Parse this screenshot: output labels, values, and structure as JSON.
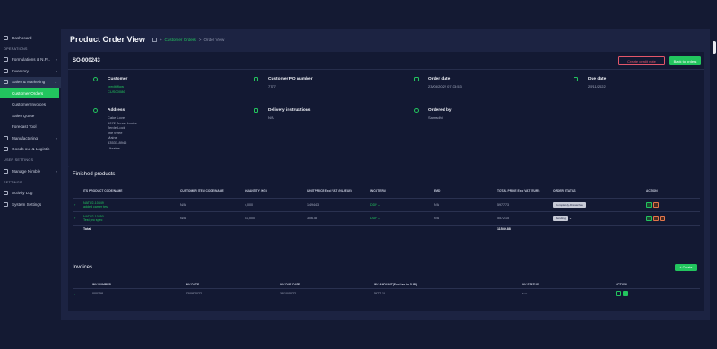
{
  "sidebar": {
    "items": [
      {
        "label": "Dashboard",
        "icon": "dashboard-icon"
      },
      {
        "section": "OPERATIONS"
      },
      {
        "label": "Formulations & N.P...",
        "icon": "flask-icon",
        "chev": "›"
      },
      {
        "label": "Inventory",
        "icon": "box-icon",
        "chev": "›"
      },
      {
        "label": "Sales & Marketing",
        "icon": "dollar-icon",
        "chev": "⌄",
        "open": true
      },
      {
        "label": "Customer Orders",
        "sub": true,
        "active": true
      },
      {
        "label": "Customer Invoices",
        "sub": true
      },
      {
        "label": "Sales Quote",
        "sub": true
      },
      {
        "label": "Forecast Tool",
        "sub": true
      },
      {
        "label": "Manufacturing",
        "icon": "factory-icon",
        "chev": "›"
      },
      {
        "label": "Goods out & Logistic",
        "icon": "truck-icon"
      },
      {
        "section": "USER SETTINGS"
      },
      {
        "label": "Manage Nimble",
        "icon": "settings-icon",
        "chev": "›"
      },
      {
        "section": "SETTINGS"
      },
      {
        "label": "Activity Log",
        "icon": "log-icon"
      },
      {
        "label": "System Settings",
        "icon": "gear-icon"
      }
    ]
  },
  "header": {
    "title": "Product Order View",
    "crumb_link": "Customer Orders",
    "crumb_sep": ">",
    "crumb_current": "Order View"
  },
  "order": {
    "number": "SO-000243",
    "create_credit_note": "Create credit note",
    "back_to_orders": "Back to orders",
    "customer_label": "Customer",
    "customer_name": "credit flow",
    "customer_code": "CUS00086",
    "po_label": "Customer PO number",
    "po_value": "7777",
    "order_date_label": "Order date",
    "order_date_value": "23/08/2022 07:33:53",
    "due_date_label": "Due date",
    "due_date_value": "25/11/2022",
    "address_label": "Address",
    "address_lines": [
      "Cake Love",
      "5072 Jenae Locks",
      "Jerde Lock",
      "line three",
      "Maine",
      "53531-8946",
      "Ukraine"
    ],
    "delivery_label": "Delivery instructions",
    "delivery_value": "N/A",
    "ordered_by_label": "Ordered by",
    "ordered_by_value": "Samadhi"
  },
  "finished_products": {
    "title": "Finished products",
    "columns": [
      "ITS PRODUCT CODE/NAME",
      "CUSTOMER ITEM CODE/NAME",
      "QUANTITY (KG)",
      "UNIT PRICE Excl VAT (NIL/EUR)",
      "INCOTERM",
      "EMD",
      "TOTAL PRICE Excl VAT (EUR)",
      "ORDER STATUS",
      "ACTION"
    ],
    "rows": [
      {
        "code": "NATU2-10849",
        "name": "added carrier test",
        "customer_item": "N/A",
        "qty": "4,000",
        "unit_price": "1494.43",
        "incoterm": "DDP",
        "emd": "N/A",
        "total": "5977.73",
        "status": "Completely-Dispatched",
        "dropdown": false
      },
      {
        "code": "NATU2-10850",
        "name": "Test pro spec",
        "customer_item": "N/A",
        "qty": "51,000",
        "unit_price": "306.58",
        "incoterm": "DDP",
        "emd": "N/A",
        "total": "5572.15",
        "status": "Pending",
        "dropdown": true
      }
    ],
    "total_label": "Total",
    "total_value": "11549.88"
  },
  "invoices": {
    "title": "Invoices",
    "create_label": "+ Create",
    "columns": [
      "INV NUMBER",
      "INV DATE",
      "INV DUE DATE",
      "INV AMOUNT (Excl tax in EUR)",
      "INV STATUS",
      "ACTION"
    ],
    "rows": [
      {
        "number": "000158",
        "date": "23/08/2022",
        "due": "18/10/2022",
        "amount": "5977.16",
        "status": "Sent"
      }
    ]
  }
}
